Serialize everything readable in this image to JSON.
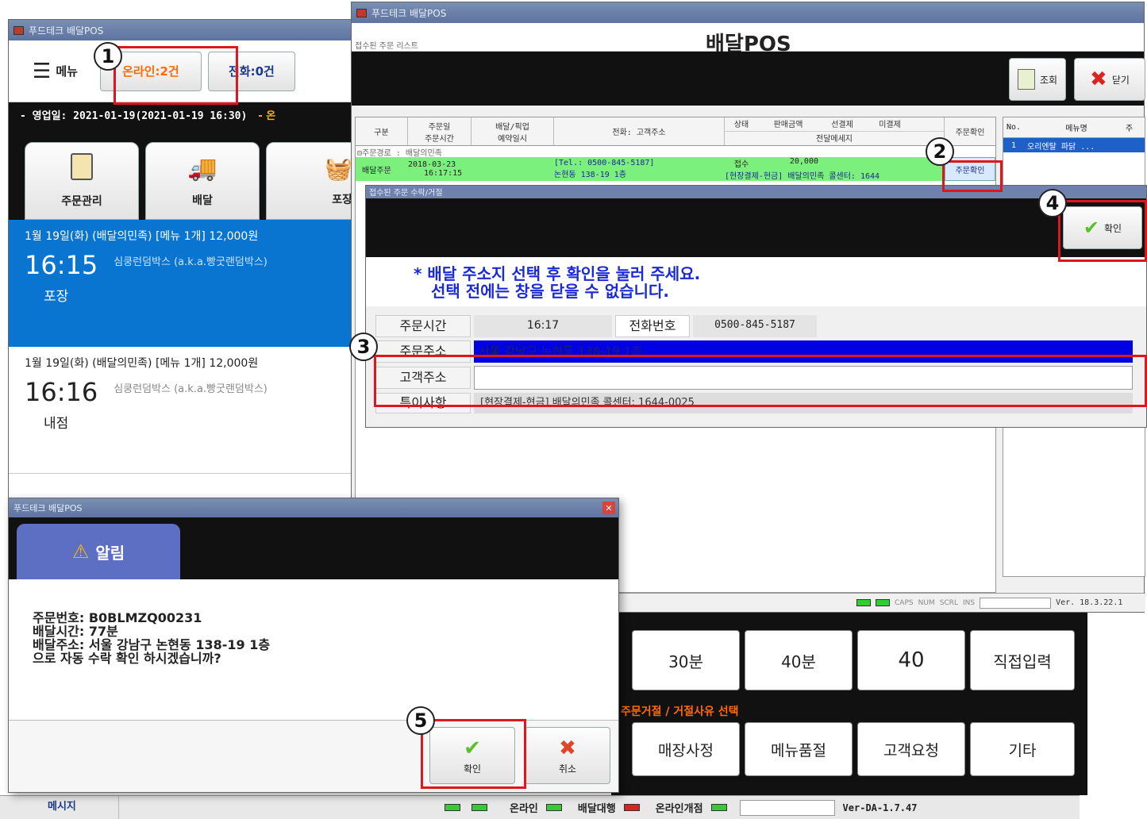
{
  "left_window": {
    "title": "푸드테크 배달POS",
    "menu_label": "메뉴",
    "tab_online": "온라인:2건",
    "tab_phone": "전화:0건",
    "business_date": "- 영업일: 2021-01-19(2021-01-19 16:30)",
    "business_date_extra": "- 온",
    "nav_buttons": [
      "주문관리",
      "배달",
      "포장"
    ],
    "orders": [
      {
        "header": "1월 19일(화)  (배달의민족)  [메뉴 1개] 12,000원",
        "time": "16:15",
        "store": "심쿵런덤박스 (a.k.a.빵굿랜덤박스)",
        "type": "포장"
      },
      {
        "header": "1월 19일(화)  (배달의민족)  [메뉴 1개] 12,000원",
        "time": "16:16",
        "store": "심쿵런덤박스 (a.k.a.빵굿랜덤박스)",
        "type": "내점"
      }
    ]
  },
  "right_window": {
    "title": "푸드테크 배달POS",
    "sub_title": "접수된 주문 리스트",
    "logo": "배달POS",
    "btn_search": "조회",
    "btn_close": "닫기",
    "table_headers": {
      "col1": "구분",
      "col2a": "주문일",
      "col2b": "주문시간",
      "col3a": "배달/픽업",
      "col3b": "예약일시",
      "col4": "전화: 고객주소",
      "col5": "상태",
      "col6": "판매금액",
      "col7": "선결제",
      "col8": "미결제",
      "col9": "전달메세지",
      "col10": "주문확인"
    },
    "group_label": "⊟주문경로 : 배달의민족",
    "order_row": {
      "type": "배달주문",
      "date": "2018-03-23",
      "time": "16:17:15",
      "tel": "[Tel.: 0500-845-5187]",
      "addr": "논현동 138-19 1층",
      "status": "접수",
      "amount": "20,000",
      "msg": "[현장결제-현금] 배달의민족 콜센터: 1644",
      "confirm": "주문확인"
    },
    "side_headers": [
      "No.",
      "메뉴명",
      "주"
    ],
    "side_row": [
      "1",
      "오리엔탈 파닭 ..."
    ],
    "status_bar": [
      "CAPS",
      "NUM",
      "SCRL",
      "INS"
    ],
    "version": "Ver. 18.3.22.1"
  },
  "dialog_address": {
    "title": "접수된 주문 수락/거절",
    "btn_confirm": "확인",
    "instruction_line1": "* 배달 주소지 선택 후 확인을 눌러 주세요.",
    "instruction_line2": "선택 전에는 창을 닫을 수 없습니다.",
    "label_order_time": "주문시간",
    "order_time": "16:17",
    "label_phone": "전화번호",
    "phone": "0500-845-5187",
    "label_order_addr": "주문주소",
    "order_addr": "서울 강남구 논현동 138-19 1층",
    "label_customer_addr": "고객주소",
    "customer_addr": "",
    "label_message": "특이사항",
    "message": "[현장결제-현금] 배달의민족 콜센터: 1644-0025"
  },
  "bottom_panel": {
    "time_buttons": [
      "30분",
      "40분",
      "40",
      "직접입력"
    ],
    "reject_title": "주문거절 / 거절사유 선택",
    "reject_buttons": [
      "매장사정",
      "메뉴품절",
      "고객요청",
      "기타"
    ],
    "status_online": "온라인",
    "status_delivery": "배달대행",
    "status_store": "온라인개점",
    "version": "Ver-DA-1.7.47"
  },
  "alert_dialog": {
    "title": "푸드테크 배달POS",
    "tab_label": "알림",
    "line1": "주문번호: B0BLMZQ00231",
    "line2": "배달시간: 77분",
    "line3": "배달주소: 서울 강남구 논현동 138-19 1층",
    "line4": "으로 자동 수락 확인 하시겠습니까?",
    "btn_ok": "확인",
    "btn_cancel": "취소"
  },
  "bottom_status": {
    "label": "메시지"
  },
  "markers": [
    "1",
    "2",
    "3",
    "4",
    "5"
  ],
  "colors": {
    "accent_blue": "#0a74d1",
    "highlight_red": "#e0161e",
    "row_green": "#7cf07c",
    "orange": "#ff6a00"
  }
}
